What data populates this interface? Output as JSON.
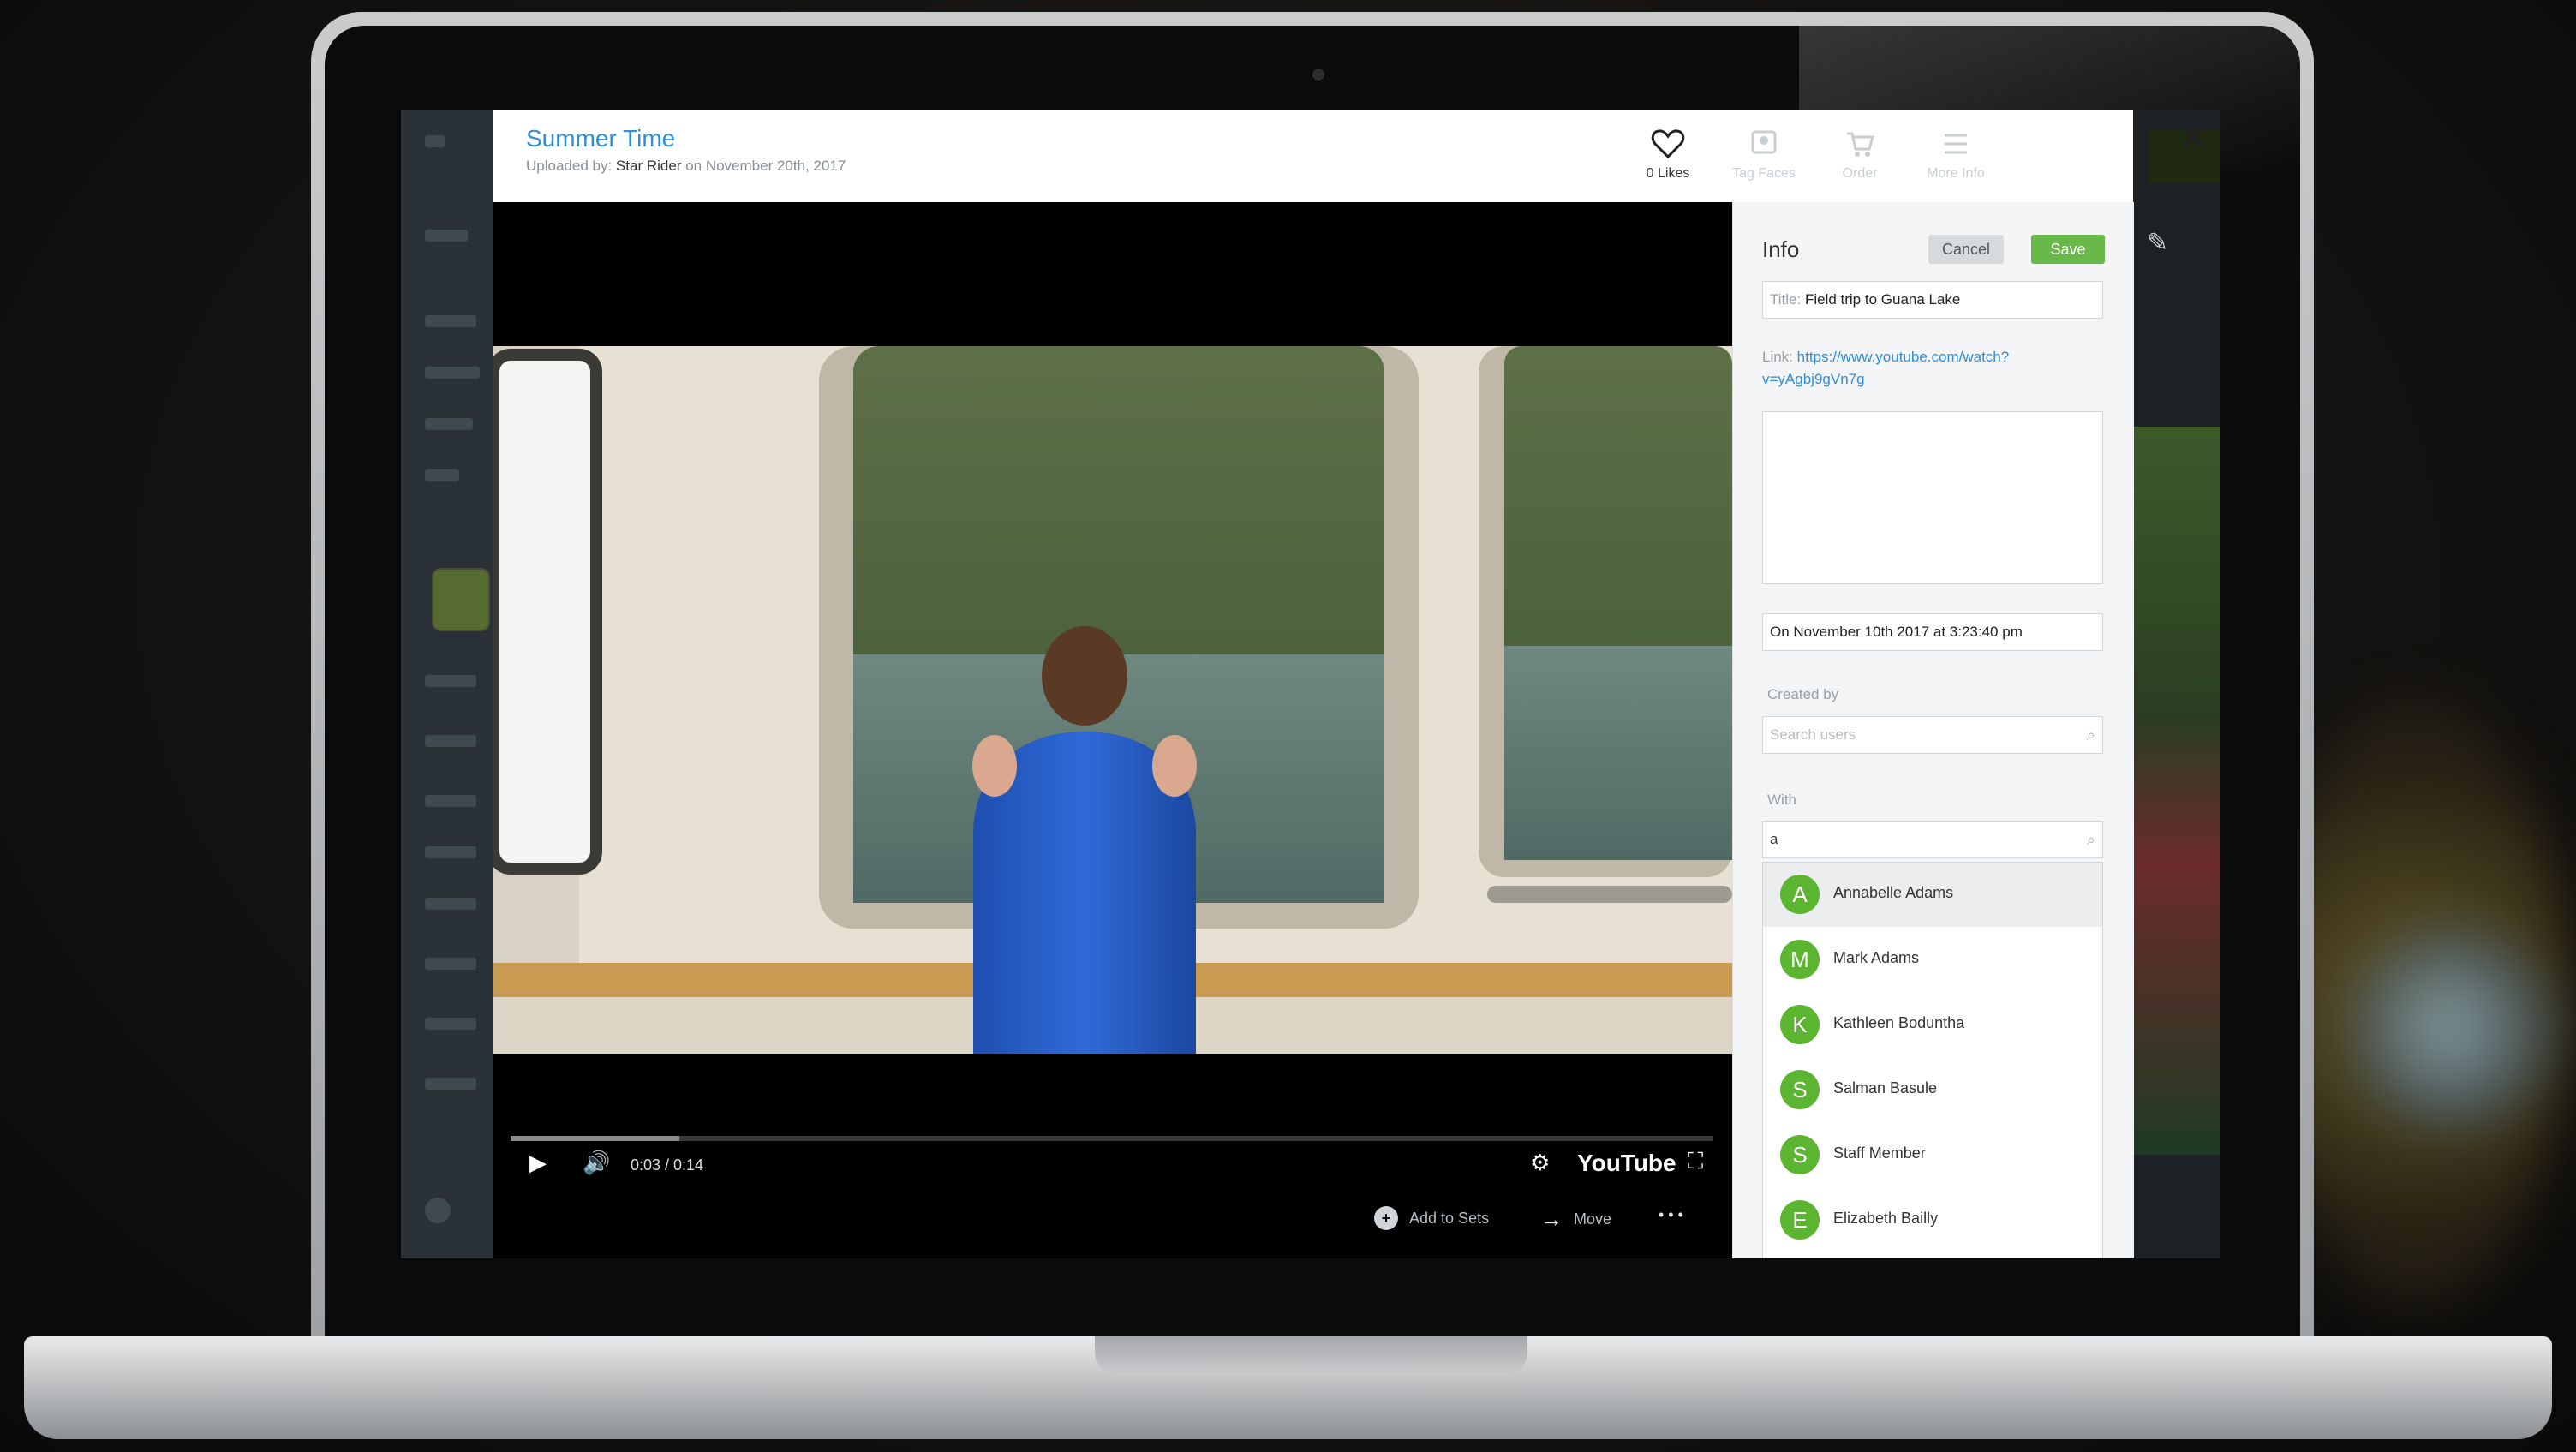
{
  "modal": {
    "title": "Summer Time",
    "uploaded_prefix": "Uploaded by:",
    "uploader": "Star Rider",
    "uploaded_suffix": "on November 20th, 2017",
    "actions": [
      {
        "label": "0 Likes",
        "icon": "heart-icon"
      },
      {
        "label": "Tag Faces",
        "icon": "tag-faces-icon"
      },
      {
        "label": "Order",
        "icon": "cart-icon"
      },
      {
        "label": "More Info",
        "icon": "list-icon"
      }
    ],
    "close": "✕"
  },
  "video": {
    "time": "0:03 / 0:14",
    "progress": 0.14,
    "brand": "YouTube",
    "footer": {
      "add_to_sets": "Add to Sets",
      "move": "Move",
      "more": "• • •"
    }
  },
  "info": {
    "heading": "Info",
    "cancel": "Cancel",
    "save": "Save",
    "title_label": "Title:",
    "title_value": "Field trip to Guana Lake",
    "link_label": "Link:",
    "link_value": "https://www.youtube.com/watch?v=yAgbj9gVn7g",
    "date_value": "On November 10th 2017 at 3:23:40 pm",
    "created_by_label": "Created by",
    "created_by_placeholder": "Search users",
    "with_label": "With",
    "with_query": "a",
    "users": [
      {
        "initial": "A",
        "name": "Annabelle Adams"
      },
      {
        "initial": "M",
        "name": "Mark Adams"
      },
      {
        "initial": "K",
        "name": "Kathleen Boduntha"
      },
      {
        "initial": "S",
        "name": "Salman Basule"
      },
      {
        "initial": "S",
        "name": "Staff Member"
      },
      {
        "initial": "E",
        "name": "Elizabeth Bailly"
      }
    ]
  },
  "colors": {
    "accent_blue": "#2f8fd8",
    "save_green": "#69b84a",
    "avatar_green": "#5cb531"
  }
}
